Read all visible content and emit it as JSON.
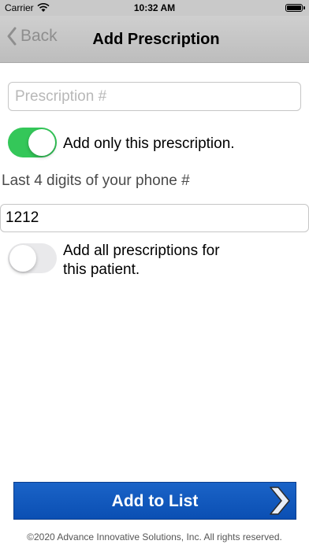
{
  "status_bar": {
    "carrier": "Carrier",
    "time": "10:32 AM",
    "wifi_icon": "wifi-icon",
    "battery_icon": "battery-icon"
  },
  "nav": {
    "back_label": "Back",
    "title": "Add Prescription"
  },
  "form": {
    "rx_placeholder": "Prescription #",
    "rx_value": "",
    "toggle_single": {
      "on": true,
      "label": "Add only this prescription."
    },
    "phone_label": "Last 4 digits of your phone #",
    "phone_value": "1212",
    "toggle_all": {
      "on": false,
      "label_line1": "Add all prescriptions for",
      "label_line2": "this patient."
    }
  },
  "action": {
    "add_label": "Add to List"
  },
  "footer": {
    "copyright": "©2020 Advance Innovative Solutions, Inc. All rights reserved."
  },
  "colors": {
    "toggle_on": "#34c759",
    "toggle_off": "#e9e9eb",
    "button_blue": "#0b56bd",
    "nav_bg": "#c6c6c6"
  }
}
